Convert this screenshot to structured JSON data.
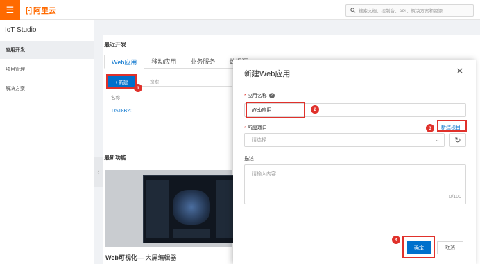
{
  "topbar": {
    "logo_mark": "[-]",
    "logo_text": "阿里云",
    "search_placeholder": "搜索文档、控制台、API、解决方案和资源"
  },
  "sidebar": {
    "title": "IoT Studio",
    "items": [
      {
        "label": "应用开发",
        "active": true
      },
      {
        "label": "项目管理",
        "active": false
      },
      {
        "label": "解决方案",
        "active": false
      }
    ]
  },
  "main": {
    "recent_title": "最近开发",
    "tabs": [
      {
        "label": "Web应用",
        "active": true
      },
      {
        "label": "移动应用",
        "active": false
      },
      {
        "label": "业务服务",
        "active": false
      },
      {
        "label": "数据源",
        "active": false
      }
    ],
    "new_button": "+ 新建",
    "list_search_placeholder": "搜索",
    "column_name": "名称",
    "rows": [
      "DS18B20"
    ],
    "features_title": "最新功能",
    "feature_name_bold": "Web可视化",
    "feature_name_rest": "— 大屏编辑器"
  },
  "modal": {
    "title": "新建Web应用",
    "name_label": "应用名称",
    "name_value": "Web应用",
    "project_label": "所属项目",
    "project_placeholder": "请选择",
    "new_project_link": "新建项目",
    "desc_label": "描述",
    "desc_placeholder": "请输入内容",
    "desc_counter": "0/100",
    "confirm": "确定",
    "cancel": "取消"
  },
  "annotations": {
    "step1": "1",
    "step2": "2",
    "step3": "3",
    "step4": "4"
  },
  "colors": {
    "accent": "#0070cc",
    "brand": "#ff6a00",
    "highlight": "#e0312b"
  }
}
